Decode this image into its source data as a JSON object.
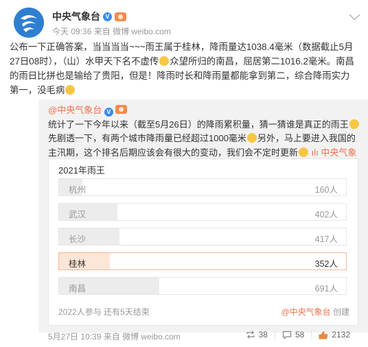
{
  "post": {
    "author": "中央气象台",
    "time": "今天 09:36",
    "source_prefix": "来自",
    "source": "微博 weibo.com",
    "text_parts": [
      "公布一下正确答案，当当当当~~~雨王属于桂林，降雨量达1038.4毫米（数据截止5月27日08时），（山）水甲天下名不虚传",
      "众望所归的南昌，屈居第二1016.2毫米。南昌的雨日比拼也是输给了贵阳，但是！降雨时长和降雨量都能拿到第二，综合降雨实力第一，没毛病"
    ]
  },
  "repost": {
    "author": "@中央气象台",
    "text_parts": [
      "统计了一下今年以来（截至5月26日）的降雨累积量，猜一猜谁是真正的雨王",
      "先剧透一下，有两个城市降雨量已经超过1000毫米",
      "另外，马上要进入我国的主汛期，这个排名后期应该会有很大的变动，我们会不定时更新",
      "中央气象台的微博投票"
    ],
    "poll": {
      "title": "2021年雨王",
      "options": [
        {
          "label": "杭州",
          "count": "160人",
          "share": 0.081
        },
        {
          "label": "武汉",
          "count": "402人",
          "share": 0.204
        },
        {
          "label": "长沙",
          "count": "417人",
          "share": 0.211
        },
        {
          "label": "桂林",
          "count": "352人",
          "share": 0.178,
          "chosen": true
        },
        {
          "label": "南昌",
          "count": "691人",
          "share": 0.35
        }
      ],
      "footer": "2022人参与 还有5天结束",
      "creator_name": "@中央气象台",
      "creator_suffix": "创建"
    },
    "time": "5月27日 10:39",
    "source_prefix": "来自",
    "source": "微博 weibo.com",
    "reposts": "38",
    "comments": "58",
    "likes": "2132"
  },
  "colors": {
    "link": "#eb7350",
    "verified": "#3a8cf0"
  }
}
